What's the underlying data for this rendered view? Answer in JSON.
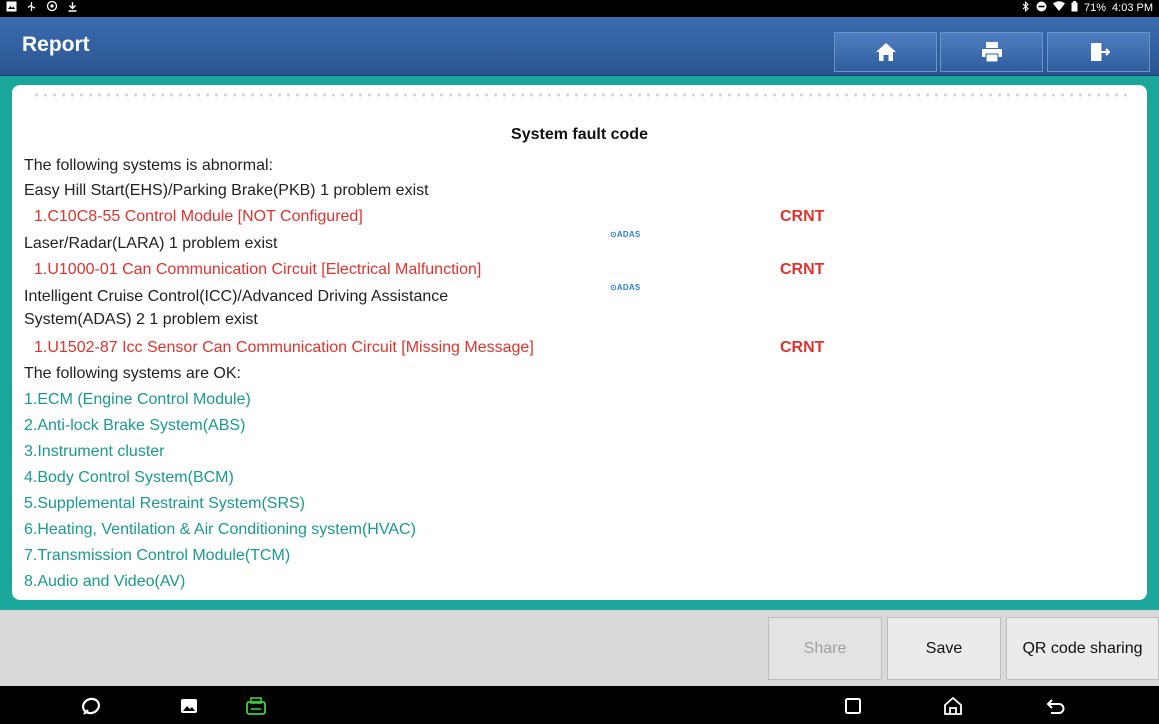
{
  "status_bar": {
    "battery": "71%",
    "time": "4:03 PM"
  },
  "header": {
    "title": "Report",
    "home_icon": "home-icon",
    "print_icon": "print-icon",
    "exit_icon": "exit-icon"
  },
  "report": {
    "title": "System fault code",
    "abnormal_heading": "The following systems is abnormal:",
    "abnormal_systems": [
      {
        "name": "Easy Hill Start(EHS)/Parking Brake(PKB) 1 problem exist",
        "fault": "1.C10C8-55 Control Module [NOT Configured]",
        "status": "CRNT"
      },
      {
        "name": "Laser/Radar(LARA) 1 problem exist",
        "fault": "1.U1000-01 Can Communication Circuit [Electrical Malfunction]",
        "status": "CRNT",
        "badge": "⊙ADAS"
      },
      {
        "name_line1": "Intelligent Cruise Control(ICC)/Advanced Driving Assistance",
        "name_line2": "System(ADAS) 2 1 problem exist",
        "fault": "1.U1502-87 Icc Sensor Can Communication Circuit [Missing Message]",
        "status": "CRNT",
        "badge": "⊙ADAS"
      }
    ],
    "ok_heading": "The following systems are OK:",
    "ok_systems": [
      "1.ECM (Engine Control Module)",
      "2.Anti-lock Brake System(ABS)",
      "3.Instrument cluster",
      "4.Body Control System(BCM)",
      "5.Supplemental Restraint System(SRS)",
      "6.Heating, Ventilation & Air Conditioning system(HVAC)",
      "7.Transmission Control Module(TCM)",
      "8.Audio and Video(AV)"
    ]
  },
  "actions": {
    "share": "Share",
    "save": "Save",
    "qr": "QR code sharing"
  },
  "colors": {
    "header_blue": "#2f5e9f",
    "frame_teal": "#1aa699",
    "fault_red": "#e0332e",
    "ok_teal": "#1a9a8c"
  }
}
